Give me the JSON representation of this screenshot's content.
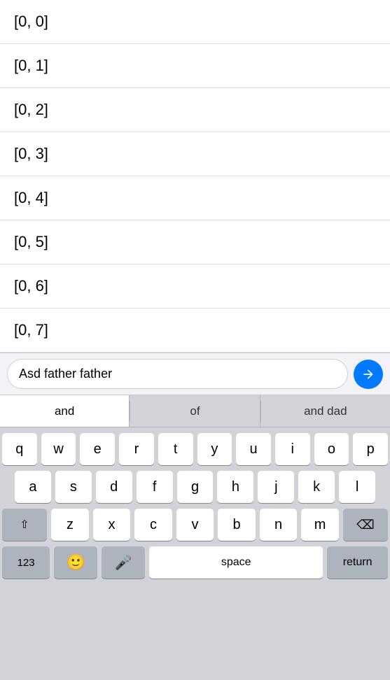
{
  "list": {
    "items": [
      "[0, 0]",
      "[0, 1]",
      "[0, 2]",
      "[0, 3]",
      "[0, 4]",
      "[0, 5]",
      "[0, 6]",
      "[0, 7]"
    ]
  },
  "input": {
    "value": "Asd father father",
    "placeholder": ""
  },
  "autocomplete": {
    "items": [
      "and",
      "of",
      "and dad"
    ]
  },
  "keyboard": {
    "rows": [
      [
        "q",
        "w",
        "e",
        "r",
        "t",
        "y",
        "u",
        "i",
        "o",
        "p"
      ],
      [
        "a",
        "s",
        "d",
        "f",
        "g",
        "h",
        "j",
        "k",
        "l"
      ],
      [
        "z",
        "x",
        "c",
        "v",
        "b",
        "n",
        "m"
      ]
    ],
    "space_label": "space",
    "return_label": "return",
    "numbers_label": "123",
    "shift_symbol": "⇧",
    "delete_symbol": "⌫",
    "emoji_symbol": "🙂",
    "mic_symbol": "🎤"
  },
  "send_icon": "↑"
}
